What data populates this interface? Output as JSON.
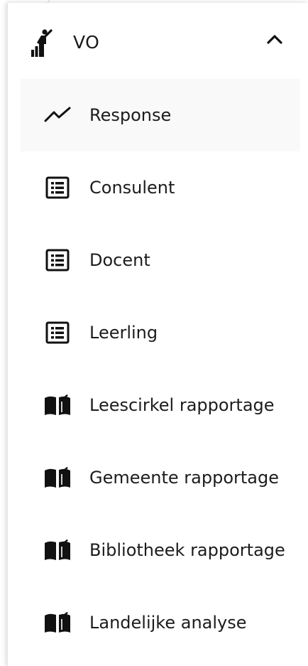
{
  "section": {
    "title": "VO",
    "icon": "runner-chart-icon",
    "expanded": true,
    "toggle_icon": "chevron-up-icon"
  },
  "menu": {
    "items": [
      {
        "label": "Response",
        "icon": "trend-line-icon",
        "active": true
      },
      {
        "label": "Consulent",
        "icon": "list-alt-icon",
        "active": false
      },
      {
        "label": "Docent",
        "icon": "list-alt-icon",
        "active": false
      },
      {
        "label": "Leerling",
        "icon": "list-alt-icon",
        "active": false
      },
      {
        "label": "Leescirkel rapportage",
        "icon": "open-book-icon",
        "active": false
      },
      {
        "label": "Gemeente rapportage",
        "icon": "open-book-icon",
        "active": false
      },
      {
        "label": "Bibliotheek rapportage",
        "icon": "open-book-icon",
        "active": false
      },
      {
        "label": "Landelijke analyse",
        "icon": "open-book-icon",
        "active": false
      }
    ]
  },
  "colors": {
    "text": "#1c1c1c",
    "active_bg": "#f9f9f9",
    "decor_curve": "#f3d2b8"
  }
}
